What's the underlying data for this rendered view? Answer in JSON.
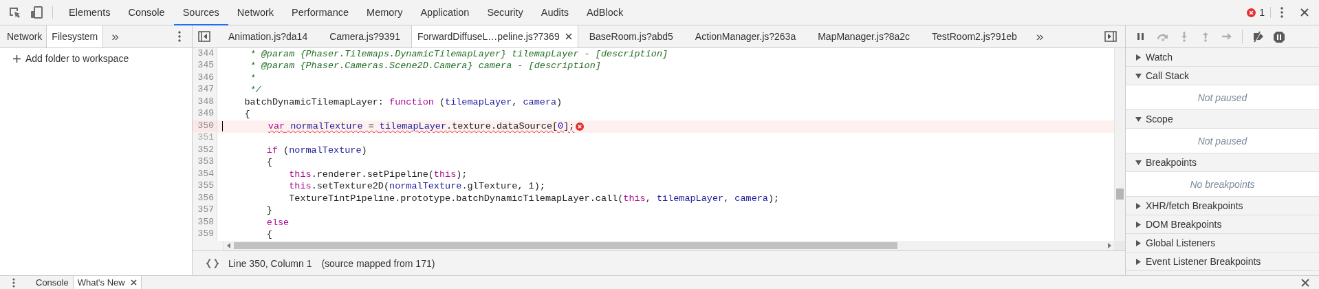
{
  "toolbar": {
    "tools": [
      {
        "kind": "inspect"
      },
      {
        "kind": "device"
      }
    ],
    "tabs": [
      {
        "label": "Elements",
        "selected": false
      },
      {
        "label": "Console",
        "selected": false
      },
      {
        "label": "Sources",
        "selected": true
      },
      {
        "label": "Network",
        "selected": false
      },
      {
        "label": "Performance",
        "selected": false
      },
      {
        "label": "Memory",
        "selected": false
      },
      {
        "label": "Application",
        "selected": false
      },
      {
        "label": "Security",
        "selected": false
      },
      {
        "label": "Audits",
        "selected": false
      },
      {
        "label": "AdBlock",
        "selected": false
      }
    ],
    "error_count": "1"
  },
  "navigator": {
    "tabs": [
      {
        "label": "Network",
        "selected": false
      },
      {
        "label": "Filesystem",
        "selected": true
      }
    ],
    "overflow": "»",
    "add_folder": "Add folder to workspace"
  },
  "editor": {
    "tabs": [
      {
        "label": "Animation.js?da14",
        "selected": false
      },
      {
        "label": "Camera.js?9391",
        "selected": false
      },
      {
        "label": "ForwardDiffuseL…peline.js?7369",
        "selected": true
      },
      {
        "label": "BaseRoom.js?abd5",
        "selected": false
      },
      {
        "label": "ActionManager.js?263a",
        "selected": false
      },
      {
        "label": "MapManager.js?8a2c",
        "selected": false
      },
      {
        "label": "TestRoom2.js?91eb",
        "selected": false
      }
    ],
    "overflow": "»",
    "lines": [
      {
        "number": "344",
        "error": false,
        "cursor": false,
        "dimmed": false,
        "tokens": [
          {
            "kind": "comment",
            "text": "     * @param {Phaser.Tilemaps.DynamicTilemapLayer} tilemapLayer - [description]"
          }
        ]
      },
      {
        "number": "345",
        "error": false,
        "cursor": false,
        "dimmed": false,
        "tokens": [
          {
            "kind": "comment",
            "text": "     * @param {Phaser.Cameras.Scene2D.Camera} camera - [description]"
          }
        ]
      },
      {
        "number": "346",
        "error": false,
        "cursor": false,
        "dimmed": false,
        "tokens": [
          {
            "kind": "comment",
            "text": "     *"
          }
        ]
      },
      {
        "number": "347",
        "error": false,
        "cursor": false,
        "dimmed": false,
        "tokens": [
          {
            "kind": "comment",
            "text": "     */"
          }
        ]
      },
      {
        "number": "348",
        "error": false,
        "cursor": false,
        "dimmed": false,
        "tokens": [
          {
            "kind": "plain",
            "text": "    batchDynamicTilemapLayer: "
          },
          {
            "kind": "keyword",
            "text": "function"
          },
          {
            "kind": "plain",
            "text": " ("
          },
          {
            "kind": "variable",
            "text": "tilemapLayer"
          },
          {
            "kind": "plain",
            "text": ", "
          },
          {
            "kind": "variable",
            "text": "camera"
          },
          {
            "kind": "plain",
            "text": ")"
          }
        ]
      },
      {
        "number": "349",
        "error": false,
        "cursor": false,
        "dimmed": false,
        "tokens": [
          {
            "kind": "plain",
            "text": "    {"
          }
        ]
      },
      {
        "number": "350",
        "error": true,
        "cursor": true,
        "dimmed": false,
        "tokens": [
          {
            "kind": "keyword",
            "text": "        var"
          },
          {
            "kind": "variable",
            "text": " normalTexture"
          },
          {
            "kind": "plain",
            "text": " = "
          },
          {
            "kind": "variable",
            "text": "tilemapLayer"
          },
          {
            "kind": "plain",
            "text": ".texture.dataSource["
          },
          {
            "kind": "number",
            "text": "0"
          },
          {
            "kind": "plain",
            "text": "];"
          }
        ]
      },
      {
        "number": "351",
        "error": false,
        "cursor": false,
        "dimmed": true
      },
      {
        "number": "352",
        "error": false,
        "cursor": false,
        "dimmed": false,
        "tokens": [
          {
            "kind": "keyword",
            "text": "        if"
          },
          {
            "kind": "plain",
            "text": " ("
          },
          {
            "kind": "variable",
            "text": "normalTexture"
          },
          {
            "kind": "plain",
            "text": ")"
          }
        ]
      },
      {
        "number": "353",
        "error": false,
        "cursor": false,
        "dimmed": false,
        "tokens": [
          {
            "kind": "plain",
            "text": "        {"
          }
        ]
      },
      {
        "number": "354",
        "error": false,
        "cursor": false,
        "dimmed": false,
        "tokens": [
          {
            "kind": "keyword",
            "text": "            this"
          },
          {
            "kind": "plain",
            "text": ".renderer.setPipeline("
          },
          {
            "kind": "keyword",
            "text": "this"
          },
          {
            "kind": "plain",
            "text": ");"
          }
        ]
      },
      {
        "number": "355",
        "error": false,
        "cursor": false,
        "dimmed": false,
        "tokens": [
          {
            "kind": "keyword",
            "text": "            this"
          },
          {
            "kind": "plain",
            "text": ".setTexture2D("
          },
          {
            "kind": "variable",
            "text": "normalTexture"
          },
          {
            "kind": "plain",
            "text": ".glTexture, 1);"
          }
        ]
      },
      {
        "number": "356",
        "error": false,
        "cursor": false,
        "dimmed": false,
        "tokens": [
          {
            "kind": "plain",
            "text": "            TextureTintPipeline.prototype.batchDynamicTilemapLayer.call("
          },
          {
            "kind": "keyword",
            "text": "this"
          },
          {
            "kind": "plain",
            "text": ", "
          },
          {
            "kind": "variable",
            "text": "tilemapLayer"
          },
          {
            "kind": "plain",
            "text": ", "
          },
          {
            "kind": "variable",
            "text": "camera"
          },
          {
            "kind": "plain",
            "text": ");"
          }
        ]
      },
      {
        "number": "357",
        "error": false,
        "cursor": false,
        "dimmed": false,
        "tokens": [
          {
            "kind": "plain",
            "text": "        }"
          }
        ]
      },
      {
        "number": "358",
        "error": false,
        "cursor": false,
        "dimmed": false,
        "tokens": [
          {
            "kind": "keyword",
            "text": "        else"
          }
        ]
      },
      {
        "number": "359",
        "error": false,
        "cursor": false,
        "dimmed": false,
        "tokens": [
          {
            "kind": "plain",
            "text": "        {"
          }
        ]
      }
    ],
    "status": {
      "position": "Line 350, Column 1",
      "source_map": "(source mapped from 171)"
    }
  },
  "debugger": {
    "buttons": [
      {
        "kind": "pause",
        "disabled": false
      },
      {
        "kind": "step-over",
        "disabled": true
      },
      {
        "kind": "step-into",
        "disabled": true
      },
      {
        "kind": "step-out",
        "disabled": true
      },
      {
        "kind": "step",
        "disabled": true
      },
      {
        "kind": "deactivate-breakpoints",
        "disabled": false
      },
      {
        "kind": "pause-on-exceptions",
        "disabled": false
      }
    ],
    "sections": [
      {
        "title": "Watch",
        "expanded": false
      },
      {
        "title": "Call Stack",
        "expanded": true,
        "body": "Not paused"
      },
      {
        "title": "Scope",
        "expanded": true,
        "body": "Not paused"
      },
      {
        "title": "Breakpoints",
        "expanded": true,
        "body": "No breakpoints"
      },
      {
        "title": "XHR/fetch Breakpoints",
        "expanded": false
      },
      {
        "title": "DOM Breakpoints",
        "expanded": false
      },
      {
        "title": "Global Listeners",
        "expanded": false
      },
      {
        "title": "Event Listener Breakpoints",
        "expanded": false
      }
    ]
  },
  "drawer": {
    "tabs": [
      {
        "label": "Console",
        "selected": false,
        "closable": false
      },
      {
        "label": "What's New",
        "selected": true,
        "closable": true
      }
    ]
  }
}
